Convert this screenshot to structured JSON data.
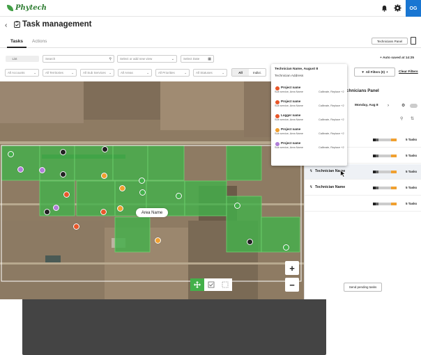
{
  "brand": {
    "name": "Phytech",
    "avatar_initials": "OG"
  },
  "header": {
    "title": "Task management"
  },
  "tabs": [
    {
      "label": "Tasks"
    },
    {
      "label": "Actions"
    }
  ],
  "technicians_panel_button": "Technicians Panel",
  "view_toggle": {
    "list": "List",
    "map": "Map"
  },
  "search": {
    "placeholder": "Search"
  },
  "view_select": {
    "placeholder": "Select or add new view"
  },
  "date_field": {
    "placeholder": "Select Date"
  },
  "autosave": "Auto saved at 14:25",
  "filters": {
    "accounts": "All Accounts",
    "territories": "All Territories",
    "sub_services": "All Sub Services",
    "areas": "All Areas",
    "priorities": "All Priorities",
    "statuses": "All Statuses",
    "seg_all": "All",
    "seg_indiv": "Indivi.",
    "all_filters": "All Filters (0)",
    "clear_filters": "Clear Filters"
  },
  "map": {
    "area_label": "Area Name"
  },
  "popup": {
    "header_name": "Technician Name, August 8",
    "header_addr": "Technician Address",
    "items": [
      {
        "title": "Project name",
        "sub": "Sub service, Area Name",
        "right": "Calibrate, Replace +2",
        "color": "#e8572a"
      },
      {
        "title": "Project name",
        "sub": "Sub service, Area Name",
        "right": "Calibrate, Replace +2",
        "color": "#e8572a"
      },
      {
        "title": "Logger name",
        "sub": "Sub service, Area Name",
        "right": "Calibrate, Replace +2",
        "color": "#e8572a"
      },
      {
        "title": "Project name",
        "sub": "Sub service, Area Name",
        "right": "Calibrate, Replace +2",
        "color": "#f0a030"
      },
      {
        "title": "Project name",
        "sub": "Sub service, Area Name",
        "right": "Calibrate, Replace +2",
        "color": "#b07fd8"
      }
    ]
  },
  "panel": {
    "title": "chnicians Panel",
    "date": "Monday, Aug 8",
    "rows": [
      {
        "name": "",
        "tasks": "5 Tasks"
      },
      {
        "name": "",
        "tasks": "5 Tasks"
      },
      {
        "name": "Technician Name",
        "tasks": "5 Tasks"
      },
      {
        "name": "Technician Name",
        "tasks": "5 Tasks"
      },
      {
        "name": "",
        "tasks": "5 Tasks"
      }
    ],
    "send_button": "Send pending tasks"
  },
  "colors": {
    "accent": "#1976d2",
    "brand_green": "#2e7d32",
    "field_green": "#43b04a",
    "orange": "#f0a030",
    "red": "#e8572a",
    "purple": "#b07fd8"
  }
}
